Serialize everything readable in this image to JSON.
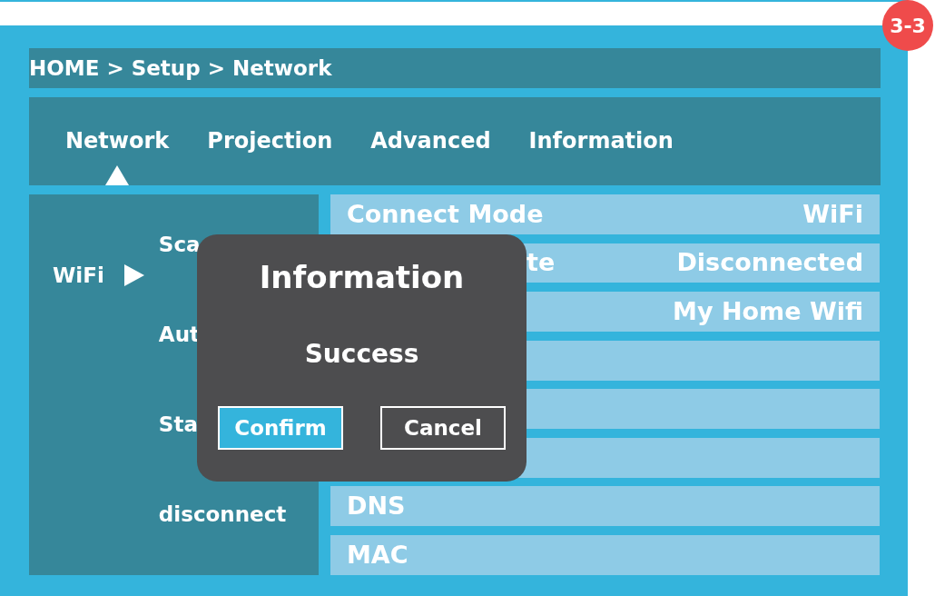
{
  "badge": "3-3",
  "breadcrumb": "HOME > Setup > Network",
  "tabs": [
    {
      "label": "Network",
      "selected": true
    },
    {
      "label": "Projection",
      "selected": false
    },
    {
      "label": "Advanced",
      "selected": false
    },
    {
      "label": "Information",
      "selected": false
    }
  ],
  "sidebar": {
    "label": "WiFi",
    "items": [
      "Sca",
      "Aut",
      "Sta",
      "disconnect"
    ]
  },
  "rows": [
    {
      "label": "Connect Mode",
      "value": "WiFi",
      "covered": false
    },
    {
      "label": "te",
      "value": "Disconnected",
      "covered": true
    },
    {
      "value": "My Home Wifi"
    },
    {},
    {},
    {},
    {
      "label": "DNS",
      "covered": false
    },
    {
      "label": "MAC",
      "covered": false
    }
  ],
  "dialog": {
    "title": "Information",
    "message": "Success",
    "buttons": [
      {
        "label": "Confirm",
        "selected": true
      },
      {
        "label": "Cancel",
        "selected": false
      }
    ]
  }
}
